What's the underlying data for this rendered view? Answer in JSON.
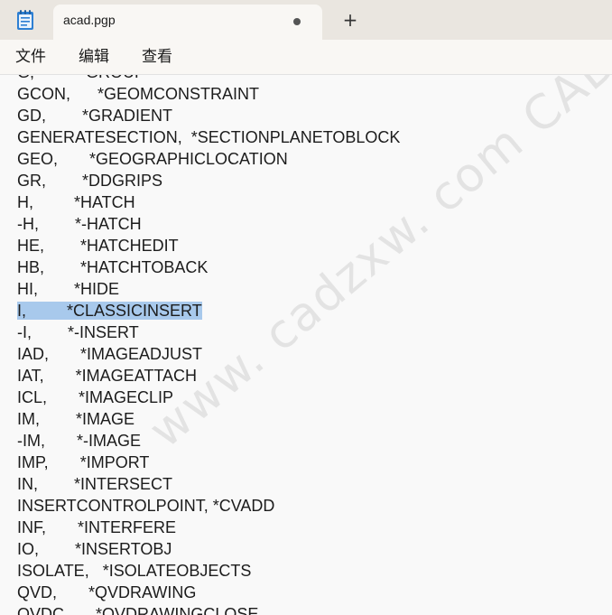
{
  "tab": {
    "title": "acad.pgp",
    "new_tab_symbol": "+"
  },
  "icons": {
    "app": "notepad-icon",
    "unsaved": "dot-icon",
    "new_tab": "plus-icon"
  },
  "menu": [
    "文件",
    "编辑",
    "查看"
  ],
  "editor": {
    "lines": [
      "G,          *GROUP",
      "GCON,      *GEOMCONSTRAINT",
      "GD,        *GRADIENT",
      "GENERATESECTION,  *SECTIONPLANETOBLOCK",
      "GEO,       *GEOGRAPHICLOCATION",
      "GR,        *DDGRIPS",
      "H,         *HATCH",
      "-H,        *-HATCH",
      "HE,        *HATCHEDIT",
      "HB,        *HATCHTOBACK",
      "HI,        *HIDE",
      "I,         *CLASSICINSERT",
      "-I,        *-INSERT",
      "IAD,       *IMAGEADJUST",
      "IAT,       *IMAGEATTACH",
      "ICL,       *IMAGECLIP",
      "IM,        *IMAGE",
      "-IM,       *-IMAGE",
      "IMP,       *IMPORT",
      "IN,        *INTERSECT",
      "INSERTCONTROLPOINT, *CVADD",
      "INF,       *INTERFERE",
      "IO,        *INSERTOBJ",
      "ISOLATE,   *ISOLATEOBJECTS",
      "QVD,       *QVDRAWING",
      "QVDC,      *QVDRAWINGCLOSE"
    ],
    "selected_line_index": 11
  },
  "watermark": "www. cadzxw. com CAD自学网",
  "colors": {
    "selection": "#a8c9ec",
    "titlebar": "#eae6e0"
  }
}
